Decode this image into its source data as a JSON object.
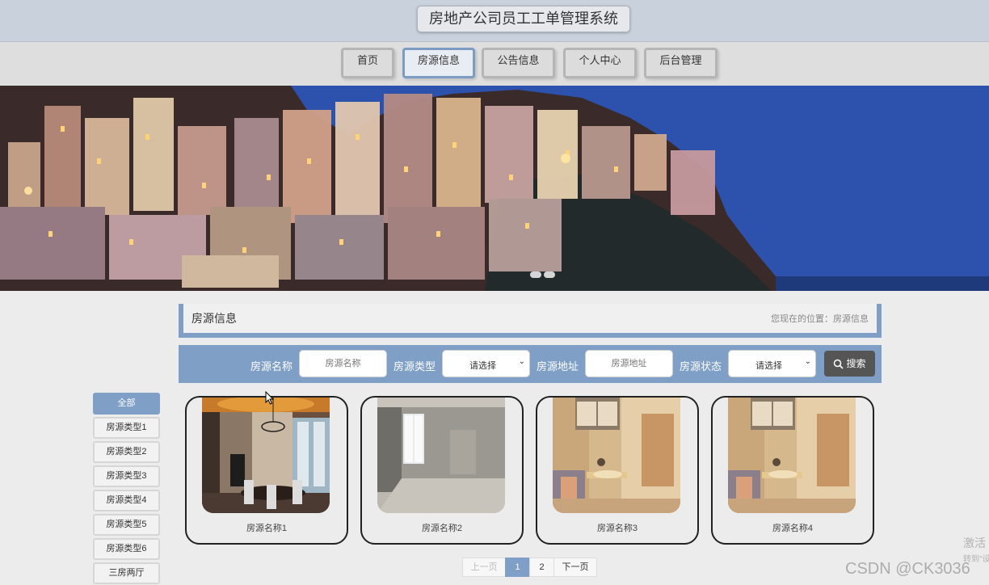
{
  "header": {
    "title": "房地产公司员工工单管理系统"
  },
  "nav": {
    "items": [
      {
        "label": "首页",
        "active": false
      },
      {
        "label": "房源信息",
        "active": true
      },
      {
        "label": "公告信息",
        "active": false
      },
      {
        "label": "个人中心",
        "active": false
      },
      {
        "label": "后台管理",
        "active": false
      }
    ]
  },
  "banner": {
    "slides": 2,
    "current": 1
  },
  "breadcrumb": {
    "title": "房源信息",
    "location": "您现在的位置：房源信息"
  },
  "search": {
    "name_label": "房源名称",
    "name_placeholder": "房源名称",
    "type_label": "房源类型",
    "type_value": "请选择",
    "address_label": "房源地址",
    "address_placeholder": "房源地址",
    "status_label": "房源状态",
    "status_value": "请选择",
    "button_label": "搜索"
  },
  "sidebar": {
    "items": [
      {
        "label": "全部",
        "active": true
      },
      {
        "label": "房源类型1",
        "active": false
      },
      {
        "label": "房源类型2",
        "active": false
      },
      {
        "label": "房源类型3",
        "active": false
      },
      {
        "label": "房源类型4",
        "active": false
      },
      {
        "label": "房源类型5",
        "active": false
      },
      {
        "label": "房源类型6",
        "active": false
      },
      {
        "label": "三房两厅",
        "active": false
      }
    ]
  },
  "listings": [
    {
      "name": "房源名称1",
      "image": "dining-room-photo"
    },
    {
      "name": "房源名称2",
      "image": "empty-room-photo"
    },
    {
      "name": "房源名称3",
      "image": "loft-living-photo"
    },
    {
      "name": "房源名称4",
      "image": "loft-living-photo"
    }
  ],
  "pagination": {
    "prev": "上一页",
    "pages": [
      "1",
      "2"
    ],
    "current": "1",
    "next": "下一页"
  },
  "overlay": {
    "watermark": "CSDN @CK3036",
    "activate_line1": "激活",
    "activate_line2": "转到\"设"
  },
  "colors": {
    "accent": "#7f9fc6",
    "header_bg": "#c9d2dc",
    "search_button": "#555555"
  }
}
